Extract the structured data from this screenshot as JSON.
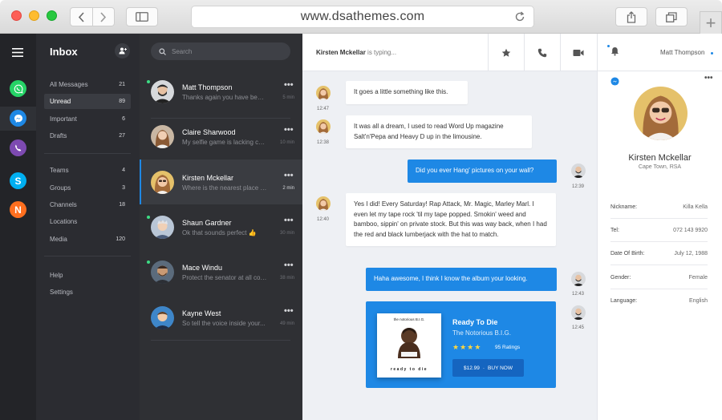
{
  "browser": {
    "url": "www.dsathemes.com",
    "new_tab": "+"
  },
  "rail": {
    "apps": [
      {
        "name": "whatsapp",
        "color": "#25d366"
      },
      {
        "name": "messenger",
        "color": "#1e88e5"
      },
      {
        "name": "viber",
        "color": "#7d4ab1"
      },
      {
        "name": "skype",
        "color": "#00aff0"
      },
      {
        "name": "n-app",
        "color": "#ff6f1f",
        "letter": "N"
      }
    ]
  },
  "nav": {
    "title": "Inbox",
    "items": [
      {
        "label": "All Messages",
        "count": "21"
      },
      {
        "label": "Unread",
        "count": "89"
      },
      {
        "label": "Important",
        "count": "6"
      },
      {
        "label": "Drafts",
        "count": "27"
      },
      {
        "label": "Teams",
        "count": "4"
      },
      {
        "label": "Groups",
        "count": "3"
      },
      {
        "label": "Channels",
        "count": "18"
      },
      {
        "label": "Locations",
        "count": ""
      },
      {
        "label": "Media",
        "count": "120"
      },
      {
        "label": "Help",
        "count": ""
      },
      {
        "label": "Settings",
        "count": ""
      }
    ]
  },
  "chats": {
    "search_placeholder": "Search",
    "items": [
      {
        "name": "Matt Thompson",
        "preview": "Thanks again you have been...",
        "time": "5 min"
      },
      {
        "name": "Claire Sharwood",
        "preview": "My selfie game is lacking can...",
        "time": "10 min"
      },
      {
        "name": "Kirsten Mckellar",
        "preview": "Where is the nearest place to...",
        "time": "2 min"
      },
      {
        "name": "Shaun Gardner",
        "preview": "Ok that sounds perfect",
        "time": "30 min"
      },
      {
        "name": "Mace Windu",
        "preview": "Protect the senator at all costs.",
        "time": "38 min"
      },
      {
        "name": "Kayne West",
        "preview": "So tell the voice inside your...",
        "time": "49 min"
      }
    ]
  },
  "conversation": {
    "typing_name": "Kirsten Mckellar",
    "typing_suffix": " is typing...",
    "messages": [
      {
        "text": "It goes a little something like this.",
        "time": "12:47"
      },
      {
        "text": "It was all a dream, I used to read Word Up magazine Salt'n'Pepa and Heavy D up in the limousine.",
        "time": "12:38"
      },
      {
        "text": "Did you ever Hang' pictures on your wall?",
        "time": "12:39"
      },
      {
        "text": "Yes I did! Every Saturday! Rap Attack, Mr. Magic, Marley Marl. I even let my tape rock 'til my tape popped. Smokin' weed and bamboo, sippin' on private stock.  But this was way back, when I had the red and black lumberjack with the hat to match.",
        "time": "12:40"
      },
      {
        "text": "Haha awesome,  I think I know the album your looking.",
        "time": "12:43"
      }
    ],
    "card": {
      "title": "Ready To Die",
      "artist": "The Notorious B.I.G.",
      "stars": "★★★★",
      "ratings": "95 Ratings",
      "price": "$12.99",
      "buy": "BUY NOW",
      "time": "12:45",
      "cover_top": "the notorious B.I.G.",
      "cover_bottom": "ready to die"
    }
  },
  "profile": {
    "user": "Matt Thompson",
    "name": "Kirsten Mckellar",
    "location": "Cape Town, RSA",
    "fields": [
      {
        "k": "Nickname:",
        "v": "Killa Kella"
      },
      {
        "k": "Tel:",
        "v": "072 143 9920"
      },
      {
        "k": "Date Of Birth:",
        "v": "July 12, 1988"
      },
      {
        "k": "Gender:",
        "v": "Female"
      },
      {
        "k": "Language:",
        "v": "English"
      }
    ]
  }
}
